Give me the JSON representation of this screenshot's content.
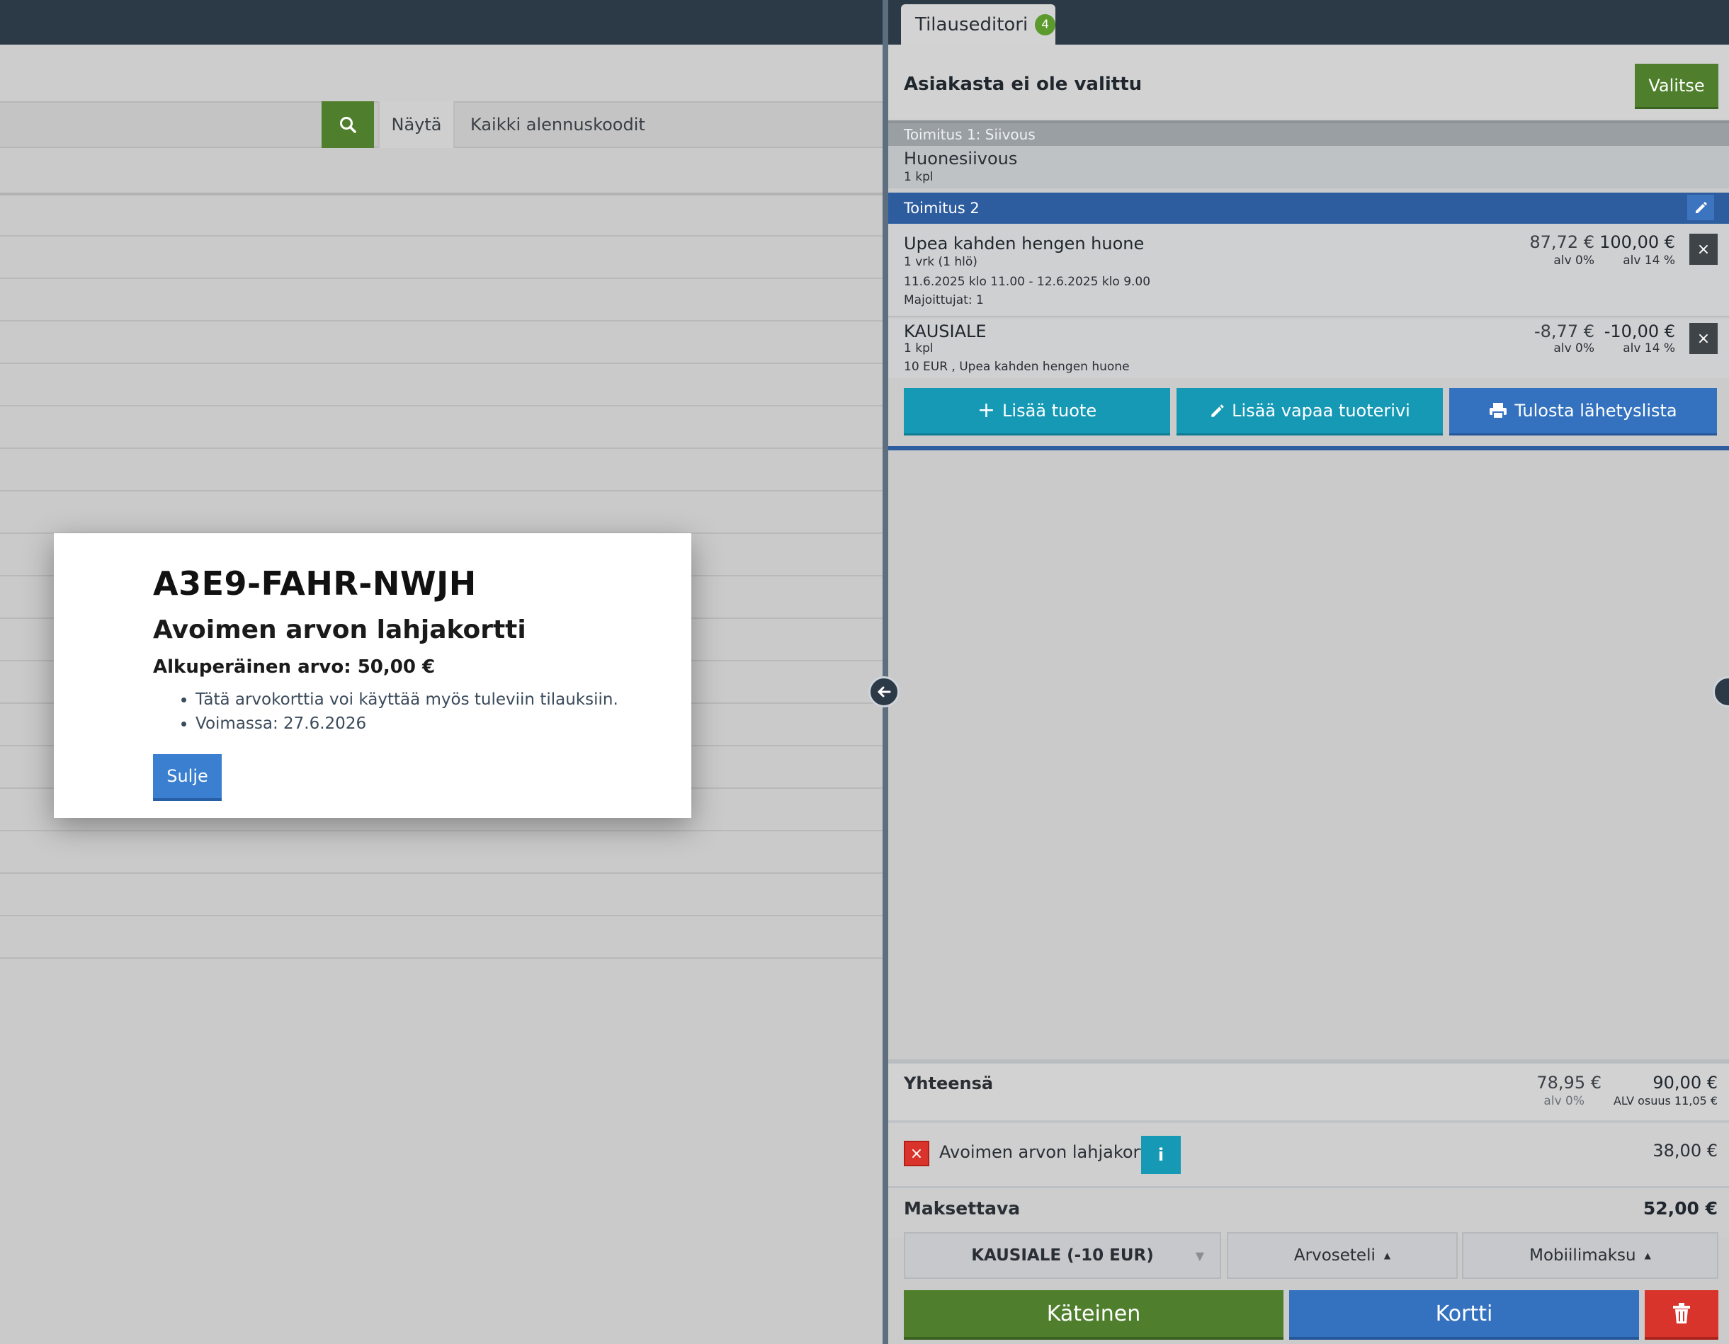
{
  "left": {
    "search": {
      "show_label": "Näytä",
      "filter_value": "Kaikki alennuskoodit"
    }
  },
  "modal": {
    "code": "A3E9-FAHR-NWJH",
    "title": "Avoimen arvon lahjakortti",
    "original_value": "Alkuperäinen arvo: 50,00 €",
    "bullets": [
      "Tätä arvokorttia voi käyttää myös tuleviin tilauksiin.",
      "Voimassa: 27.6.2026"
    ],
    "close_label": "Sulje"
  },
  "editor": {
    "tab_label": "Tilauseditori",
    "tab_badge": "4",
    "customer_label": "Asiakasta ei ole valittu",
    "choose_label": "Valitse",
    "delivery1": {
      "header": "Toimitus 1: Siivous",
      "name": "Huonesiivous",
      "qty": "1 kpl"
    },
    "delivery2": {
      "header": "Toimitus 2"
    },
    "rows": [
      {
        "name": "Upea kahden hengen huone",
        "line1": "1 vrk (1 hlö)",
        "line2": "11.6.2025 klo 11.00 - 12.6.2025 klo 9.00",
        "line3": "Majoittujat: 1",
        "price_excl": "87,72 €",
        "vat_excl": "alv 0%",
        "price_incl": "100,00 €",
        "vat_incl": "alv 14 %",
        "remove": "×"
      },
      {
        "name": "KAUSIALE",
        "line1": "1 kpl",
        "line2": "10 EUR , Upea kahden hengen huone",
        "price_excl": "-8,77 €",
        "vat_excl": "alv 0%",
        "price_incl": "-10,00 €",
        "vat_incl": "alv 14 %",
        "remove": "×"
      }
    ],
    "actions": {
      "add_product": "Lisää tuote",
      "add_free_row": "Lisää vapaa tuoterivi",
      "print_list": "Tulosta lähetyslista"
    },
    "total": {
      "label": "Yhteensä",
      "excl": "78,95 €",
      "excl_vat": "alv 0%",
      "incl": "90,00 €",
      "vat_share": "ALV osuus 11,05 €"
    },
    "gift_card": {
      "remove": "×",
      "name": "Avoimen arvon lahjakortti",
      "info": "i",
      "amount": "38,00 €"
    },
    "payable": {
      "label": "Maksettava",
      "amount": "52,00 €"
    },
    "dropdowns": {
      "discount": "KAUSIALE (-10 EUR)",
      "voucher": "Arvoseteli",
      "mobile": "Mobiilimaksu"
    },
    "pay": {
      "cash": "Käteinen",
      "card": "Kortti"
    }
  },
  "colors": {
    "accent_green": "#4f7f2c",
    "accent_blue": "#3472bf",
    "teal": "#1699b5",
    "danger": "#d9342b",
    "nav_dark": "#2c3a47"
  }
}
